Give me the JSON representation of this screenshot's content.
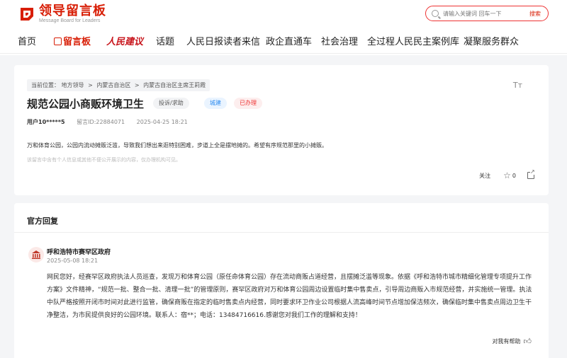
{
  "header": {
    "logo_title": "领导留言板",
    "logo_sub": "Message Board for Leaders",
    "search_placeholder": "请输入关键词 回车一下",
    "search_button": "搜索",
    "nav": [
      {
        "label": "首页"
      },
      {
        "label": "留言板"
      },
      {
        "label": "人民建议"
      },
      {
        "label": "话题"
      },
      {
        "label": "人民日报读者来信"
      },
      {
        "label": "政企直通车"
      },
      {
        "label": "社会治理"
      },
      {
        "label": "全过程人民民主案例库"
      },
      {
        "label": "凝聚服务群众"
      }
    ],
    "accent_color": "#d81e06"
  },
  "message": {
    "breadcrumb": [
      "当前位置：",
      "地方领导",
      "内蒙古自治区",
      "内蒙古自治区主席王莉霞"
    ],
    "breadcrumb_sep": ">",
    "font_size_icon": "Tт",
    "title": "规范公园小商贩环境卫生",
    "tags": {
      "type": "投诉/求助",
      "category": "城建",
      "status": "已办理"
    },
    "user": "用户10*****5",
    "message_id": "留言ID:22884071",
    "time": "2025-04-25 18:21",
    "content": "万和体育公园，公园内流动摊贩泛滥，导致我们想出来逛特别困难，步道上全是摆地摊的。希望有序规范那里的小摊贩。",
    "notice": "该留言中含有个人信息或其他不便公开展示的内容，仅办理机构可见。",
    "actions": {
      "follow": "关注",
      "likes": "0"
    }
  },
  "reply": {
    "heading": "官方回复",
    "org": "呼和浩特市赛罕区政府",
    "time": "2025-05-08 18:21",
    "body": "网民您好，经赛罕区政府执法人员巡查，发现万和体育公园（原任命体育公园）存在流动商贩占道经营，且摆摊泛滥等现象。依据《呼和浩特市城市精细化管理专项提升工作方案》文件精神，“规范一批、整合一批、清理一批”的管理原则，赛罕区政府对万和体育公园周边设置临时集中售卖点，引导周边商贩入市规范经营，并实施统一管理。执法中队严格按照开闭市时间对此进行监管，确保商贩在指定的临时售卖点内经营，同时要求环卫作业公司根据人流高峰时间节点增加保洁频次，确保临时集中售卖点周边卫生干净整洁，为市民提供良好的公园环境。联系人：宿**；电话：13484716616.感谢您对我们工作的理解和支持！",
    "helpful": "对我有帮助"
  }
}
